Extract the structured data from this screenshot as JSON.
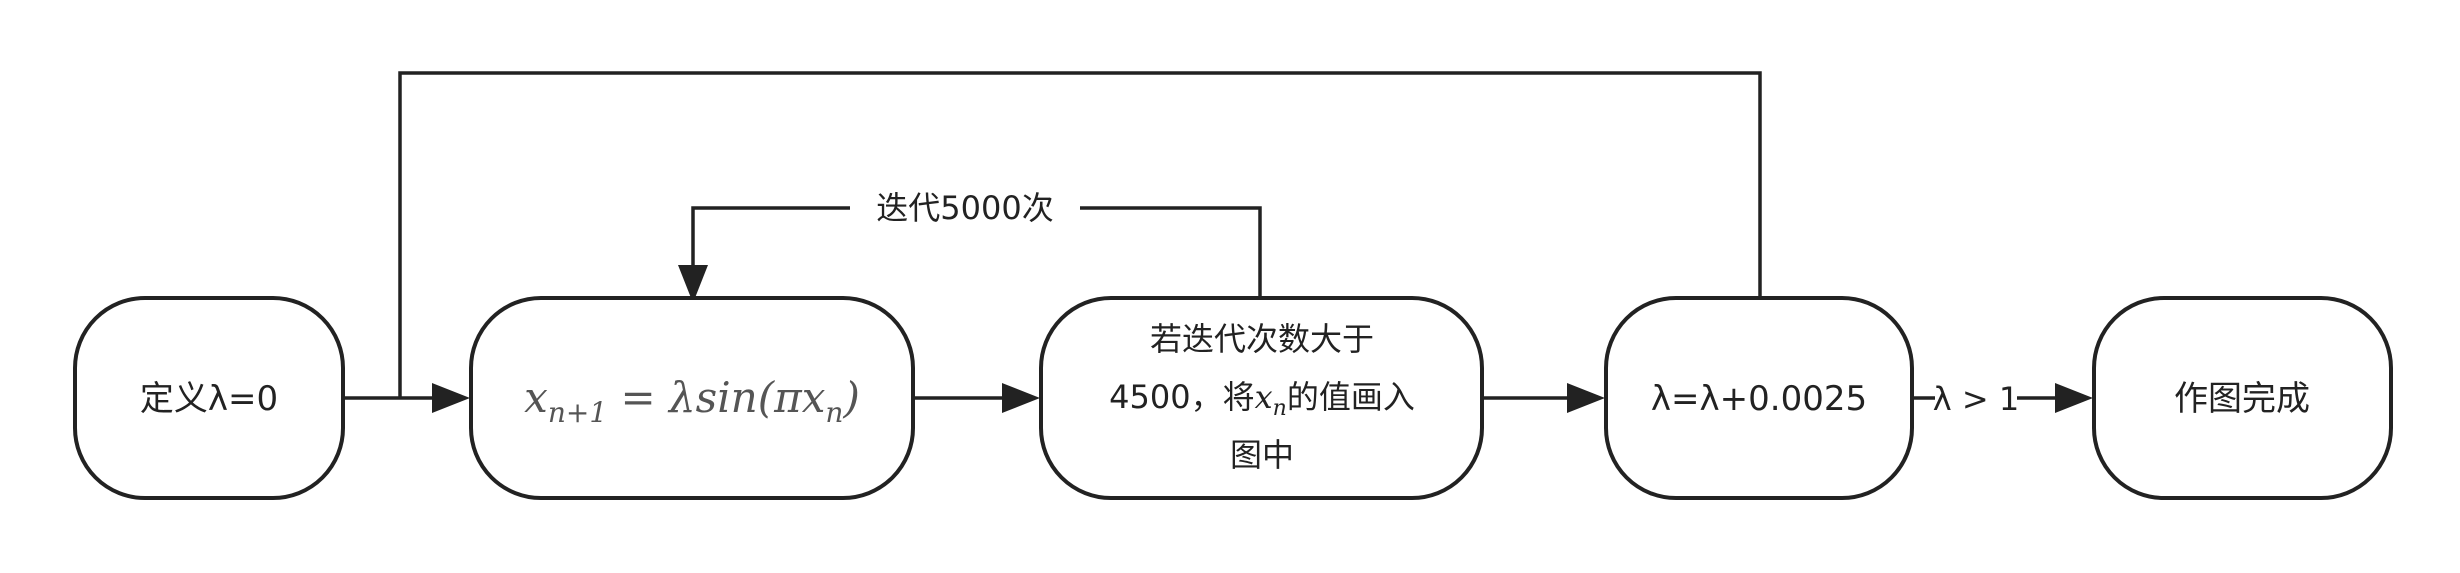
{
  "nodes": {
    "define": {
      "label": "定义λ=0"
    },
    "formula": {
      "label": "x",
      "sub": "n+1",
      "rest": " = λsin(πx",
      "sub2": "n",
      "close": ")"
    },
    "condition": {
      "line1": "若迭代次数大于",
      "line2a": "4500，将",
      "line2var": "x",
      "line2sub": "n",
      "line2b": "的值画入",
      "line3": "图中"
    },
    "increment": {
      "label": "λ=λ+0.0025"
    },
    "done": {
      "label": "作图完成"
    }
  },
  "edges": {
    "loop": {
      "label": "迭代5000次"
    },
    "exit": {
      "label": "λ > 1"
    }
  }
}
